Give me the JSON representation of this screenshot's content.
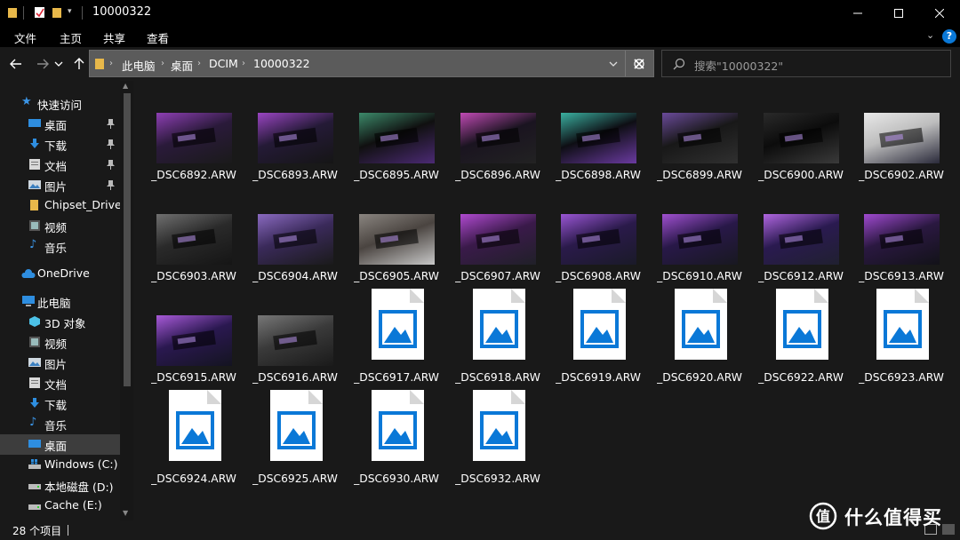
{
  "window": {
    "title": "10000322"
  },
  "ribbon": {
    "tabs": [
      "文件",
      "主页",
      "共享",
      "查看"
    ]
  },
  "address": {
    "crumbs": [
      "此电脑",
      "桌面",
      "DCIM",
      "10000322"
    ],
    "search_placeholder": "搜索\"10000322\""
  },
  "sidebar": {
    "quick_access": "快速访问",
    "pinned": [
      "桌面",
      "下载",
      "文档",
      "图片"
    ],
    "recent": [
      "Chipset_Driver_",
      "视频",
      "音乐"
    ],
    "onedrive": "OneDrive",
    "this_pc": "此电脑",
    "pc_items": [
      "3D 对象",
      "视频",
      "图片",
      "文档",
      "下载",
      "音乐",
      "桌面",
      "Windows (C:)",
      "本地磁盘 (D:)",
      "Cache (E:)"
    ]
  },
  "files": [
    {
      "name": "_DSC6892.ARW",
      "preview": "thumb"
    },
    {
      "name": "_DSC6893.ARW",
      "preview": "thumb"
    },
    {
      "name": "_DSC6895.ARW",
      "preview": "thumb"
    },
    {
      "name": "_DSC6896.ARW",
      "preview": "thumb"
    },
    {
      "name": "_DSC6898.ARW",
      "preview": "thumb"
    },
    {
      "name": "_DSC6899.ARW",
      "preview": "thumb"
    },
    {
      "name": "_DSC6900.ARW",
      "preview": "thumb"
    },
    {
      "name": "_DSC6902.ARW",
      "preview": "thumb"
    },
    {
      "name": "_DSC6903.ARW",
      "preview": "thumb"
    },
    {
      "name": "_DSC6904.ARW",
      "preview": "thumb"
    },
    {
      "name": "_DSC6905.ARW",
      "preview": "thumb"
    },
    {
      "name": "_DSC6907.ARW",
      "preview": "thumb"
    },
    {
      "name": "_DSC6908.ARW",
      "preview": "thumb"
    },
    {
      "name": "_DSC6910.ARW",
      "preview": "thumb"
    },
    {
      "name": "_DSC6912.ARW",
      "preview": "thumb"
    },
    {
      "name": "_DSC6913.ARW",
      "preview": "thumb"
    },
    {
      "name": "_DSC6915.ARW",
      "preview": "thumb"
    },
    {
      "name": "_DSC6916.ARW",
      "preview": "thumb"
    },
    {
      "name": "_DSC6917.ARW",
      "preview": "generic"
    },
    {
      "name": "_DSC6918.ARW",
      "preview": "generic"
    },
    {
      "name": "_DSC6919.ARW",
      "preview": "generic"
    },
    {
      "name": "_DSC6920.ARW",
      "preview": "generic"
    },
    {
      "name": "_DSC6922.ARW",
      "preview": "generic"
    },
    {
      "name": "_DSC6923.ARW",
      "preview": "generic"
    },
    {
      "name": "_DSC6924.ARW",
      "preview": "generic"
    },
    {
      "name": "_DSC6925.ARW",
      "preview": "generic"
    },
    {
      "name": "_DSC6930.ARW",
      "preview": "generic"
    },
    {
      "name": "_DSC6932.ARW",
      "preview": "generic"
    }
  ],
  "status": {
    "count": "28 个项目"
  },
  "watermark": {
    "text": "什么值得买"
  },
  "colors": {
    "background": "#191919",
    "chrome": "#000000",
    "accent": "#0a78d7",
    "address_bg": "#5b5b5b",
    "selected": "#3d3d3d"
  }
}
